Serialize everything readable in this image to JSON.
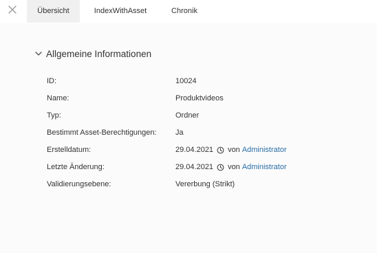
{
  "tabs": [
    {
      "label": "Übersicht",
      "active": true
    },
    {
      "label": "IndexWithAsset",
      "active": false
    },
    {
      "label": "Chronik",
      "active": false
    }
  ],
  "section": {
    "title": "Allgemeine Informationen"
  },
  "fields": {
    "id": {
      "label": "ID:",
      "value": "10024"
    },
    "name": {
      "label": "Name:",
      "value": "Produktvideos"
    },
    "type": {
      "label": "Typ:",
      "value": "Ordner"
    },
    "asset_permissions": {
      "label": "Bestimmt Asset-Berechtigungen:",
      "value": "Ja"
    },
    "created": {
      "label": "Erstelldatum:",
      "date": "29.04.2021",
      "by": "von",
      "user": "Administrator"
    },
    "modified": {
      "label": "Letzte Änderung:",
      "date": "29.04.2021",
      "by": "von",
      "user": "Administrator"
    },
    "validation": {
      "label": "Validierungsebene:",
      "value": "Vererbung (Strikt)"
    }
  },
  "colors": {
    "link": "#2a6ea6",
    "active_tab_bg": "#f0f0f0",
    "panel_bg": "#fbfbfb"
  }
}
